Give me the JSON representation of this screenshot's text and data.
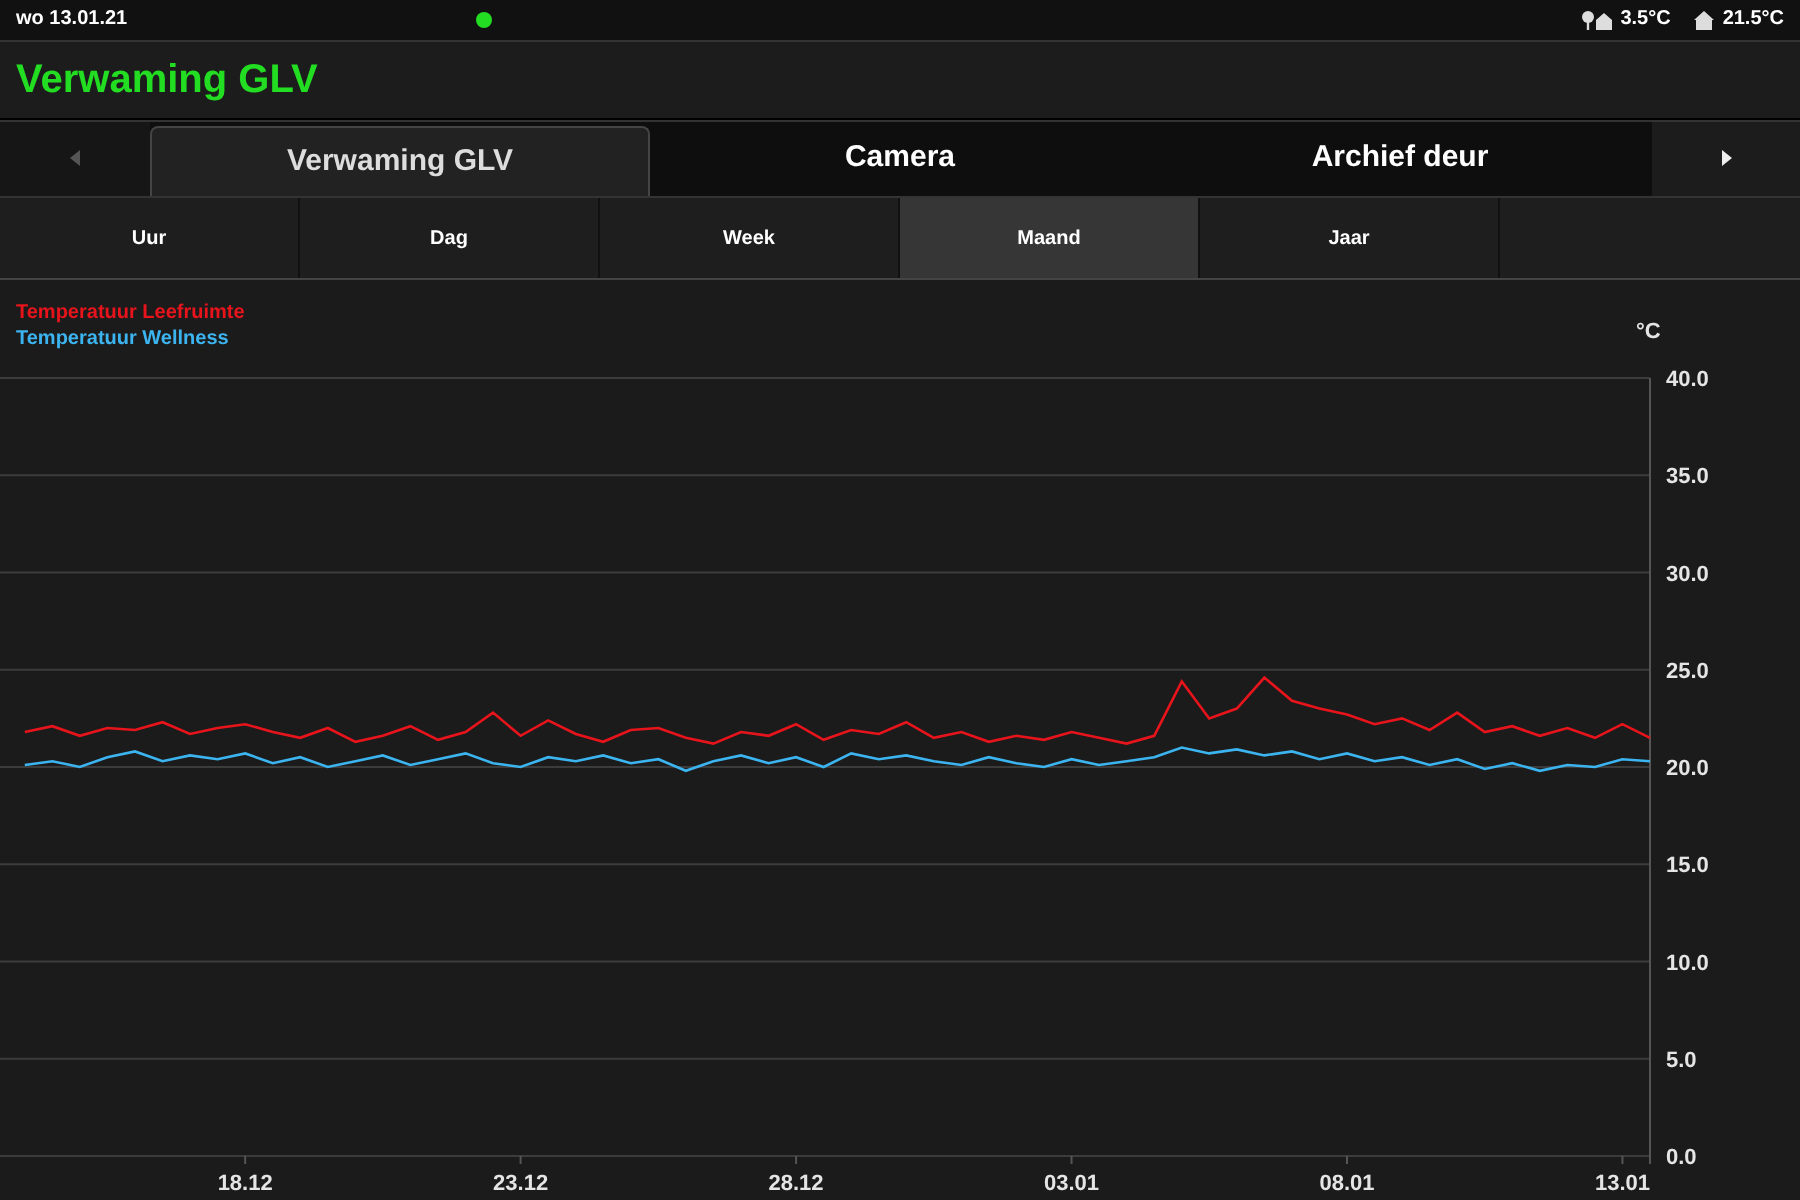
{
  "status_bar": {
    "date": "wo 13.01.21",
    "connected": true,
    "outdoor_temp": "3.5°C",
    "indoor_temp": "21.5°C"
  },
  "header": {
    "title": "Verwaming GLV"
  },
  "tabs": [
    {
      "label": "Verwaming GLV",
      "selected": true
    },
    {
      "label": "Camera",
      "selected": false
    },
    {
      "label": "Archief deur",
      "selected": false
    }
  ],
  "period_tabs": [
    {
      "label": "Uur",
      "selected": false
    },
    {
      "label": "Dag",
      "selected": false
    },
    {
      "label": "Week",
      "selected": false
    },
    {
      "label": "Maand",
      "selected": true
    },
    {
      "label": "Jaar",
      "selected": false
    }
  ],
  "chart": {
    "chart_data": {
      "type": "line",
      "grid": true,
      "ylabel": "°C",
      "ylim": [
        0,
        40
      ],
      "yticks": [
        {
          "value": 0,
          "label": "0.0"
        },
        {
          "value": 5,
          "label": "5.0"
        },
        {
          "value": 10,
          "label": "10.0"
        },
        {
          "value": 15,
          "label": "15.0"
        },
        {
          "value": 20,
          "label": "20.0"
        },
        {
          "value": 25,
          "label": "25.0"
        },
        {
          "value": 30,
          "label": "30.0"
        },
        {
          "value": 35,
          "label": "35.0"
        },
        {
          "value": 40,
          "label": "40.0"
        }
      ],
      "categories": [
        null,
        null,
        null,
        null,
        null,
        null,
        null,
        null,
        "18.12",
        null,
        null,
        null,
        null,
        null,
        null,
        null,
        null,
        null,
        "23.12",
        null,
        null,
        null,
        null,
        null,
        null,
        null,
        null,
        null,
        "28.12",
        null,
        null,
        null,
        null,
        null,
        null,
        null,
        null,
        null,
        "03.01",
        null,
        null,
        null,
        null,
        null,
        null,
        null,
        null,
        null,
        "08.01",
        null,
        null,
        null,
        null,
        null,
        null,
        null,
        null,
        null,
        "13.01",
        null
      ],
      "series": [
        {
          "name": "Temperatuur Leefruimte",
          "color": "#e8141c",
          "values": [
            21.8,
            22.1,
            21.6,
            22.0,
            21.9,
            22.3,
            21.7,
            22.0,
            22.2,
            21.8,
            21.5,
            22.0,
            21.3,
            21.6,
            22.1,
            21.4,
            21.8,
            22.8,
            21.6,
            22.4,
            21.7,
            21.3,
            21.9,
            22.0,
            21.5,
            21.2,
            21.8,
            21.6,
            22.2,
            21.4,
            21.9,
            21.7,
            22.3,
            21.5,
            21.8,
            21.3,
            21.6,
            21.4,
            21.8,
            21.5,
            21.2,
            21.6,
            24.4,
            22.5,
            23.0,
            24.6,
            23.4,
            23.0,
            22.7,
            22.2,
            22.5,
            21.9,
            22.8,
            21.8,
            22.1,
            21.6,
            22.0,
            21.5,
            22.2,
            21.5
          ]
        },
        {
          "name": "Temperatuur Wellness",
          "color": "#3cb4f0",
          "values": [
            20.1,
            20.3,
            20.0,
            20.5,
            20.8,
            20.3,
            20.6,
            20.4,
            20.7,
            20.2,
            20.5,
            20.0,
            20.3,
            20.6,
            20.1,
            20.4,
            20.7,
            20.2,
            20.0,
            20.5,
            20.3,
            20.6,
            20.2,
            20.4,
            19.8,
            20.3,
            20.6,
            20.2,
            20.5,
            20.0,
            20.7,
            20.4,
            20.6,
            20.3,
            20.1,
            20.5,
            20.2,
            20.0,
            20.4,
            20.1,
            20.3,
            20.5,
            21.0,
            20.7,
            20.9,
            20.6,
            20.8,
            20.4,
            20.7,
            20.3,
            20.5,
            20.1,
            20.4,
            19.9,
            20.2,
            19.8,
            20.1,
            20.0,
            20.4,
            20.3
          ]
        }
      ]
    }
  }
}
